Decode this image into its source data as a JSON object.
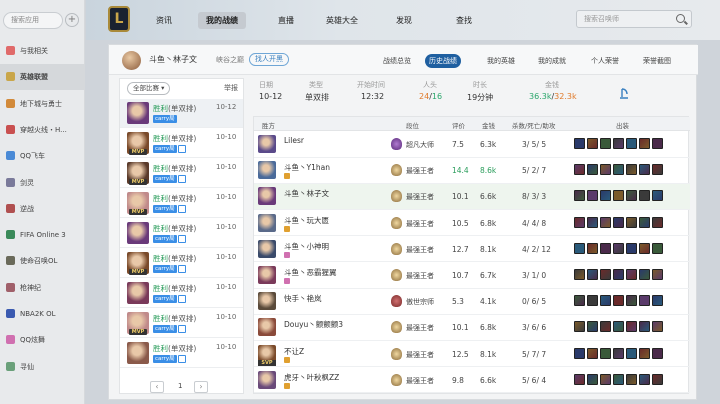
{
  "sidebar": {
    "search_placeholder": "搜索应用",
    "add": "+",
    "items": [
      {
        "label": "与我相关",
        "color": "#e06a6a"
      },
      {
        "label": "英雄联盟",
        "color": "#c9a64a",
        "active": true
      },
      {
        "label": "地下城与勇士",
        "color": "#d28a3a"
      },
      {
        "label": "穿越火线・H...",
        "color": "#c95050"
      },
      {
        "label": "QQ飞车",
        "color": "#4a8ad6"
      },
      {
        "label": "剑灵",
        "color": "#7a7a9a"
      },
      {
        "label": "逆战",
        "color": "#b05050"
      },
      {
        "label": "FIFA Online 3",
        "color": "#3a8a5a"
      },
      {
        "label": "使命召唤OL",
        "color": "#6a6a5a"
      },
      {
        "label": "枪神纪",
        "color": "#a0606a"
      },
      {
        "label": "NBA2K OL",
        "color": "#3a5ab0"
      },
      {
        "label": "QQ炫舞",
        "color": "#d070b0"
      },
      {
        "label": "寻仙",
        "color": "#6aa07a"
      }
    ]
  },
  "topnav": {
    "logo": "L",
    "items": [
      "资讯",
      "我的战绩",
      "直播",
      "英雄大全",
      "发现",
      "查找"
    ],
    "active": 1,
    "search_placeholder": "搜索召唤师"
  },
  "profile": {
    "name": "斗鱼丶林子文",
    "server": "峡谷之巅",
    "open_button": "找人开黑",
    "tabs": [
      "战绩总览",
      "历史战绩",
      "我的英雄",
      "我的成就",
      "个人荣誉",
      "荣誉截图"
    ],
    "active_tab": 1
  },
  "match_list": {
    "filter": "全部比赛 ▾",
    "report": "举报",
    "page": "1",
    "prev": "‹",
    "next": "›",
    "rows": [
      {
        "result": "胜利",
        "type": "(单双排)",
        "date": "10-12",
        "badge": "carry局",
        "mvp": false,
        "color": "#6a3a7a",
        "selected": true
      },
      {
        "result": "胜利",
        "type": "(单双排)",
        "date": "10-10",
        "badge": "carry局",
        "mvp": true,
        "color": "#7a4a2a"
      },
      {
        "result": "胜利",
        "type": "(单双排)",
        "date": "10-10",
        "badge": "carry局",
        "mvp": true,
        "color": "#5a3a2a"
      },
      {
        "result": "胜利",
        "type": "(单双排)",
        "date": "10-10",
        "badge": "carry局",
        "mvp": true,
        "color": "#c08a8a"
      },
      {
        "result": "胜利",
        "type": "(单双排)",
        "date": "10-10",
        "badge": "carry局",
        "mvp": false,
        "color": "#6a3a7a"
      },
      {
        "result": "胜利",
        "type": "(单双排)",
        "date": "10-10",
        "badge": "carry局",
        "mvp": true,
        "color": "#7a4a2a"
      },
      {
        "result": "胜利",
        "type": "(单双排)",
        "date": "10-10",
        "badge": "carry局",
        "mvp": false,
        "color": "#7a3a5a"
      },
      {
        "result": "胜利",
        "type": "(单双排)",
        "date": "10-10",
        "badge": "carry局",
        "mvp": true,
        "color": "#c08a8a"
      },
      {
        "result": "胜利",
        "type": "(单双排)",
        "date": "10-10",
        "badge": "carry局",
        "mvp": false,
        "color": "#8a5a4a"
      }
    ]
  },
  "summary": {
    "headers": [
      "日期",
      "类型",
      "开始时间",
      "人头",
      "时长",
      "金钱"
    ],
    "date": "10-12",
    "type": "单双排",
    "start": "12:32",
    "kills_a": "24",
    "kills_sep": "/",
    "kills_b": "16",
    "duration": "19分钟",
    "gold_a": "36.3k",
    "gold_sep": "/",
    "gold_b": "32.3k"
  },
  "table": {
    "headers": [
      "胜方",
      "段位",
      "评价",
      "金钱",
      "杀数/死亡/助攻",
      "出装"
    ],
    "rows": [
      {
        "name": "Lilesr",
        "rank": "超凡大师",
        "score": "7.5",
        "gold": "6.3k",
        "kda": "3/ 5/ 5",
        "color": "#5a4a8a",
        "mark": "",
        "mvp": false
      },
      {
        "name": "斗鱼丶Y1han",
        "rank": "最强王者",
        "score": "14.4",
        "gold": "8.6k",
        "kda": "5/ 2/ 7",
        "color": "#4a6a9a",
        "mark": "#e0a030",
        "mvp": false,
        "green": true
      },
      {
        "name": "斗鱼丶林子文",
        "rank": "最强王者",
        "score": "10.1",
        "gold": "6.6k",
        "kda": "8/ 3/ 3",
        "color": "#6a3a7a",
        "mark": "",
        "mvp": false,
        "me": true
      },
      {
        "name": "斗鱼丶玩大匮",
        "rank": "最强王者",
        "score": "10.5",
        "gold": "6.8k",
        "kda": "4/ 4/ 8",
        "color": "#5a6a8a",
        "mark": "#e0a030",
        "mvp": false
      },
      {
        "name": "斗鱼丶小神明",
        "rank": "最强王者",
        "score": "12.7",
        "gold": "8.1k",
        "kda": "4/ 2/ 12",
        "color": "#3a4a6a",
        "mark": "#d070b0",
        "mvp": false
      },
      {
        "name": "斗鱼丶恶霸猩翼",
        "rank": "最强王者",
        "score": "10.7",
        "gold": "6.7k",
        "kda": "3/ 1/ 0",
        "color": "#7a3a5a",
        "mark": "#d070b0",
        "mvp": false
      },
      {
        "name": "快手丶艳岚",
        "rank": "傲世宗师",
        "score": "5.3",
        "gold": "4.1k",
        "kda": "0/ 6/ 5",
        "color": "#5a4a3a",
        "mark": "",
        "mvp": false
      },
      {
        "name": "Douyu丶颤颤颤3",
        "rank": "最强王者",
        "score": "10.1",
        "gold": "6.8k",
        "kda": "3/ 6/ 6",
        "color": "#8a4a3a",
        "mark": "",
        "mvp": false
      },
      {
        "name": "不让Z",
        "rank": "最强王者",
        "score": "12.5",
        "gold": "8.1k",
        "kda": "5/ 7/ 7",
        "color": "#7a4a2a",
        "mark": "#e0a030",
        "mvp": true
      },
      {
        "name": "虎牙丶叶秋枫ZZ",
        "rank": "最强王者",
        "score": "9.8",
        "gold": "6.6k",
        "kda": "5/ 6/ 4",
        "color": "#6a4a7a",
        "mark": "#e0a030",
        "mvp": false
      }
    ]
  },
  "item_palette": [
    "#2a3a6a",
    "#6a2a2a",
    "#3a5a3a",
    "#5a3a6a",
    "#2a5a7a",
    "#7a5a2a",
    "#4a2a4a",
    "#3a3a3a"
  ]
}
